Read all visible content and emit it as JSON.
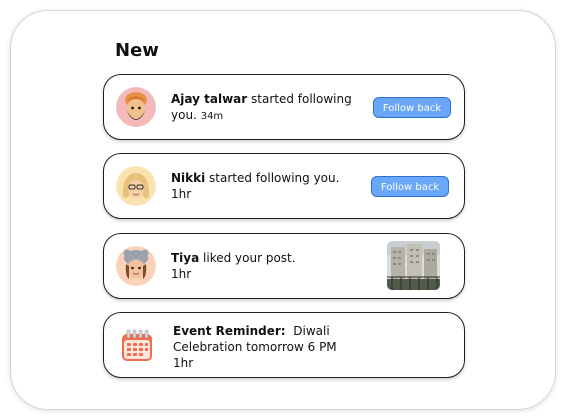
{
  "heading": "New",
  "notifications": [
    {
      "name": "Ajay talwar",
      "message": " started following you.",
      "time": "34m",
      "action": "Follow back"
    },
    {
      "name": "Nikki",
      "message": " started following you.",
      "time": "1hr",
      "action": "Follow back"
    },
    {
      "name": "Tiya",
      "message": " liked your post.",
      "time": "1hr"
    },
    {
      "name": "Event Reminder:",
      "message": "Diwali Celebration tomorrow 6 PM",
      "time": "1hr"
    }
  ],
  "colors": {
    "button_bg": "#6aa7f8",
    "button_border": "#2f6fd1",
    "card_border": "#1f1f1f"
  },
  "icons": {
    "notification_1": "avatar-sikh-man",
    "notification_2": "avatar-blonde-woman",
    "notification_3": "avatar-woman-beanie",
    "notification_4": "calendar-icon"
  }
}
